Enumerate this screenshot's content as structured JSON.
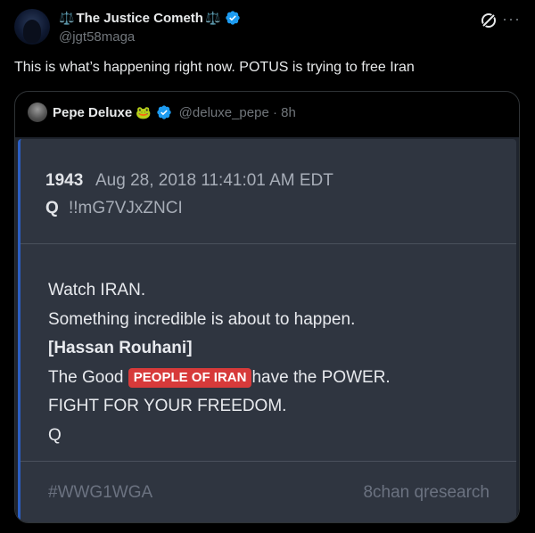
{
  "tweet": {
    "author": {
      "name": "The Justice Cometh",
      "emoji": "⚖️",
      "handle": "@jgt58maga",
      "verified": true,
      "verified_color": "#1d9bf0"
    },
    "text": "This is what’s happening right now. POTUS is trying to free Iran",
    "icons": {
      "grok": "grok-icon",
      "more": "more-icon"
    }
  },
  "quote": {
    "author": {
      "name": "Pepe Deluxe",
      "emoji": "🐸",
      "handle": "@deluxe_pepe",
      "time": "8h",
      "verified": true
    },
    "post": {
      "number": "1943",
      "date": "Aug 28, 2018 11:41:01 AM EDT",
      "q": "Q",
      "tripcode": "!!mG7VJxZNCI",
      "lines": [
        "Watch IRAN.",
        "Something incredible is about to happen.",
        "[Hassan Rouhani]",
        "The Good",
        "PEOPLE OF IRAN",
        "have the POWER.",
        "FIGHT FOR YOUR FREEDOM.",
        "Q"
      ],
      "highlight_color": "#d73a3a",
      "hashtag": "#WWG1WGA",
      "source": "8chan qresearch"
    }
  }
}
